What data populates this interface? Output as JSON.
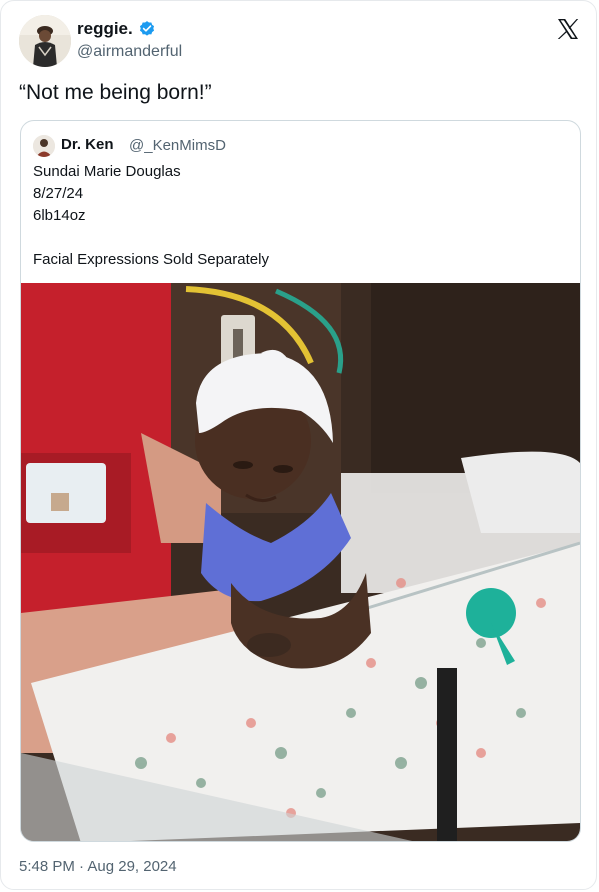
{
  "post": {
    "author": {
      "display_name": "reggie.",
      "handle": "@airmanderful",
      "verified": true,
      "verified_color": "#1d9bf0"
    },
    "text": "“Not me being born!”",
    "timestamp": "5:48 PM · Aug 29, 2024",
    "brand_icon": "x-logo-icon"
  },
  "quote": {
    "author": {
      "display_name": "Dr. Ken",
      "handle": "@_KenMimsD"
    },
    "lines": [
      "Sundai Marie Douglas",
      "8/27/24",
      "6lb14oz",
      "Facial Expressions Sold Separately"
    ],
    "media": "photo"
  }
}
